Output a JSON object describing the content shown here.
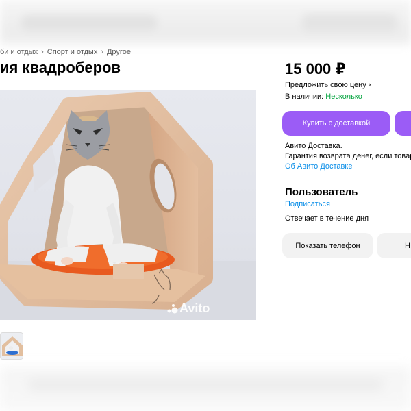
{
  "breadcrumbs": [
    "би и отдых",
    "Спорт и отдых",
    "Другое"
  ],
  "breadcrumb_separator": "›",
  "title": "ия квадроберов",
  "price": "15 000 ₽",
  "offer_price_label": "Предложить свою цену",
  "offer_chevron": "›",
  "stock": {
    "label": "В наличии:",
    "value": "Несколько"
  },
  "buy_button_label": "Купить с доставкой",
  "delivery": {
    "line1": "Авито Доставка.",
    "line2": "Гарантия возврата денег, если товар",
    "link": "Об Авито Доставке"
  },
  "seller": {
    "name": "Пользователь",
    "subscribe": "Подписаться",
    "reply_time": "Отвечает в течение дня"
  },
  "show_phone_label": "Показать телефон",
  "message_button_partial": "Н",
  "watermark": "Avito",
  "colors": {
    "accent": "#9b5cf6",
    "link": "#0a8ee8",
    "in_stock": "#02a33d",
    "secondary_button": "#f2f2f2"
  }
}
